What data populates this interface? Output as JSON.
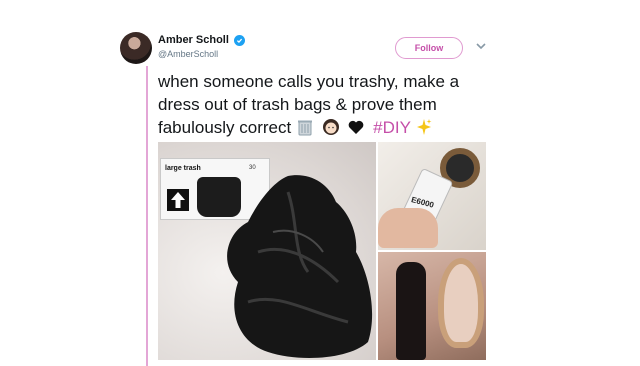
{
  "colors": {
    "accent": "#e09ad0",
    "hashtag": "#c54fa9",
    "thread_line": "#e3a6d6",
    "verified": "#1da1f2"
  },
  "tweet": {
    "author": {
      "display_name": "Amber Scholl",
      "handle": "@AmberScholl",
      "verified": true
    },
    "follow_label": "Follow",
    "text_main": "when someone calls you trashy, make a dress out of trash bags & prove them fabulously correct",
    "hashtag": "#DIY",
    "emojis": [
      "wastebasket-emoji",
      "woman-emoji",
      "black-heart-emoji",
      "sparkles-emoji"
    ]
  },
  "media": {
    "box_label": "large trash",
    "box_count": "30",
    "glue_label": "E6000"
  }
}
